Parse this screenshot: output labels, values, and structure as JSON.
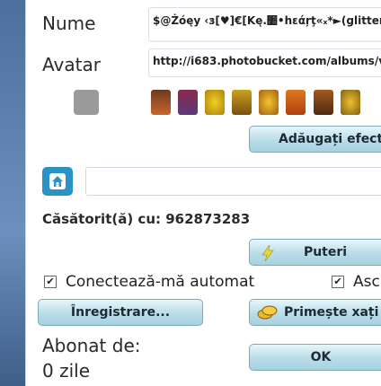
{
  "labels": {
    "name": "Nume",
    "avatar": "Avatar",
    "married": "Căsătorit(ă) cu: 962873283",
    "subscribed": "Abonat de:",
    "days": "0 zile"
  },
  "fields": {
    "name_value": "$@Żóęy ‹з[♥]€[Kę.׺•hεάŗţ«ₓ*►(glitterf",
    "avatar_url": "http://i683.photobucket.com/albums/v"
  },
  "buttons": {
    "add_effects": "Adăugați efecte",
    "powers": "Puteri",
    "register": "Înregistrare...",
    "get_coins": "Primește xați",
    "ok": "OK"
  },
  "checkboxes": {
    "auto_connect": "Conectează-mă automat",
    "second": "Asc",
    "mark": "✔"
  },
  "colors": {
    "accent": "#2b93c4",
    "button_top": "#e6f6fa",
    "button_bottom": "#a6d2df"
  },
  "icons": {
    "home": "home-icon",
    "lightning": "lightning-icon",
    "coins": "coins-icon"
  }
}
